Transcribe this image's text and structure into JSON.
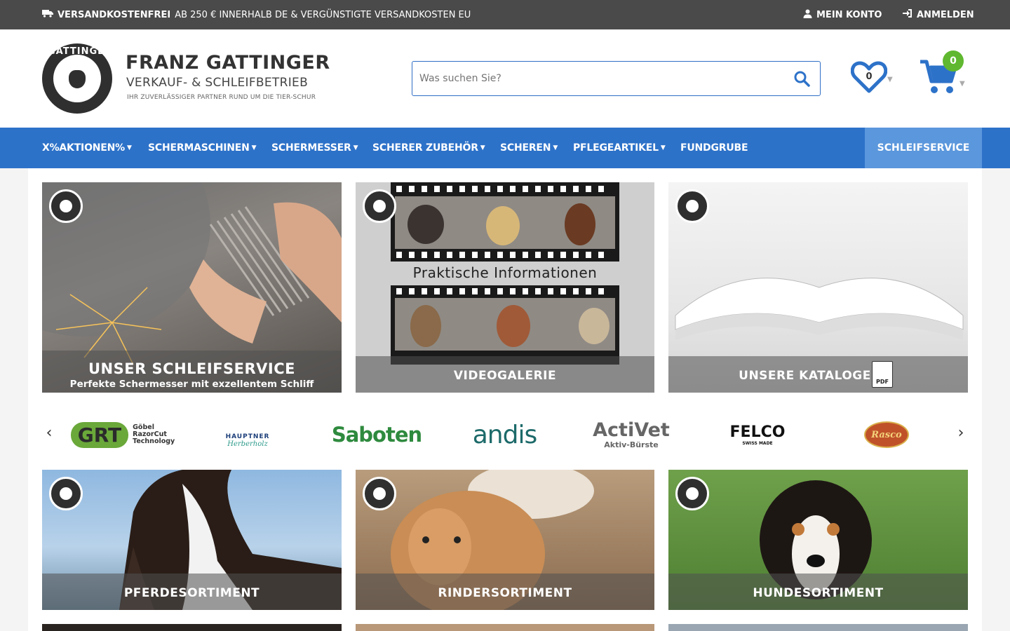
{
  "topbar": {
    "shipping_bold": "VERSANDKOSTENFREI",
    "shipping_rest": "AB 250 € INNERHALB DE & VERGÜNSTIGTE VERSANDKOSTEN EU",
    "account": "MEIN KONTO",
    "login": "ANMELDEN"
  },
  "brand": {
    "title": "FRANZ GATTINGER",
    "subtitle": "VERKAUF- & SCHLEIFBETRIEB",
    "tagline": "IHR ZUVERLÄSSIGER PARTNER RUND UM DIE TIER-SCHUR",
    "seal_text": "GATTINGER"
  },
  "search": {
    "placeholder": "Was suchen Sie?"
  },
  "wishlist": {
    "count": "0"
  },
  "cart": {
    "count": "0"
  },
  "nav": {
    "items": [
      {
        "label": "X%AKTIONEN%"
      },
      {
        "label": "SCHERMASCHINEN"
      },
      {
        "label": "SCHERMESSER"
      },
      {
        "label": "SCHERER ZUBEHÖR"
      },
      {
        "label": "SCHEREN"
      },
      {
        "label": "PFLEGEARTIKEL"
      },
      {
        "label": "FUNDGRUBE"
      }
    ],
    "highlight": "SCHLEIFSERVICE"
  },
  "tiles": {
    "schleif": {
      "title": "UNSER SCHLEIFSERVICE",
      "subtitle": "Perfekte Schermesser mit exzellentem Schliff"
    },
    "video": {
      "title": "VIDEOGALERIE",
      "banner": "Praktische Informationen"
    },
    "kataloge": {
      "title": "UNSERE KATALOGE",
      "pdf": "PDF"
    },
    "pferd": {
      "title": "PFERDESORTIMENT"
    },
    "rind": {
      "title": "RINDERSORTIMENT"
    },
    "hund": {
      "title": "HUNDESORTIMENT"
    }
  },
  "brands": {
    "grt": {
      "mark": "GRT",
      "text1": "Göbel",
      "text2": "RazorCut",
      "text3": "Technology"
    },
    "hauptner": {
      "name": "HAUPTNER",
      "script": "Herberholz"
    },
    "saboten": "Saboten",
    "andis": "andis",
    "activet": {
      "name": "ActiVet",
      "sub": "Aktiv-Bürste"
    },
    "felco": {
      "name": "FELCO",
      "sub": "SWISS MADE"
    },
    "rasco": "Rasco"
  },
  "colors": {
    "nav": "#2d72c9",
    "accent": "#5fb82f",
    "topbar": "#4a4a4a"
  }
}
